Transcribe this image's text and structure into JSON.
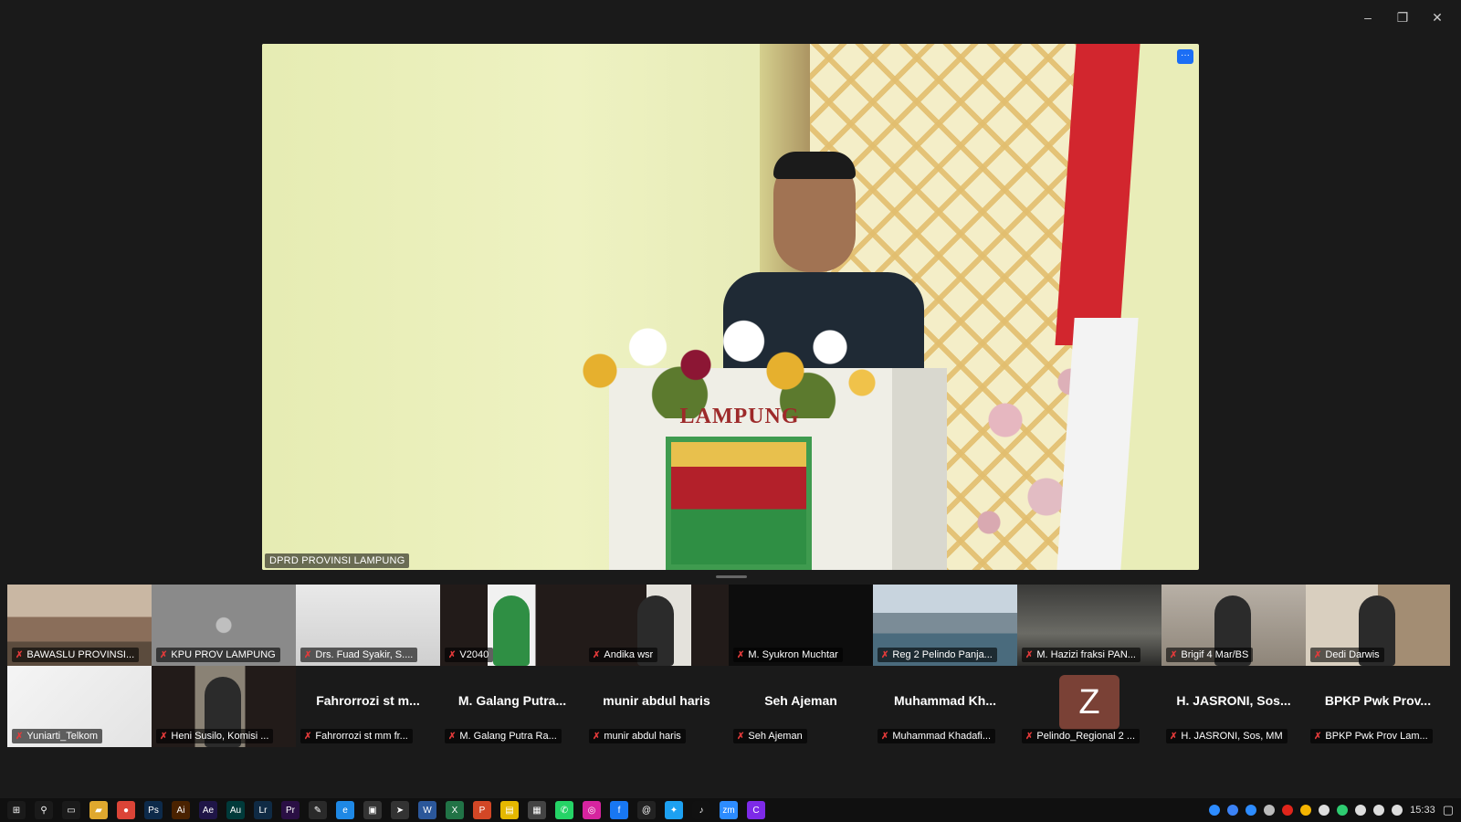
{
  "window": {
    "minimize": "–",
    "restore": "❐",
    "close": "✕"
  },
  "main_video": {
    "label": "DPRD PROVINSI LAMPUNG",
    "podium_text": "LAMPUNG",
    "more_button": "···"
  },
  "gallery": [
    {
      "name": "BAWASLU PROVINSI...",
      "center": "",
      "style": "photo-building",
      "avatar": ""
    },
    {
      "name": "KPU PROV LAMPUNG",
      "center": "",
      "style": "photo-gray",
      "avatar": ""
    },
    {
      "name": "Drs. Fuad Syakir, S....",
      "center": "",
      "style": "photo-light",
      "avatar": ""
    },
    {
      "name": "V2040",
      "center": "",
      "style": "photo-person-green",
      "avatar": ""
    },
    {
      "name": "Andika wsr",
      "center": "",
      "style": "photo-person-suit",
      "avatar": ""
    },
    {
      "name": "M. Syukron Muchtar",
      "center": "",
      "style": "photo-dark",
      "avatar": ""
    },
    {
      "name": "Reg 2 Pelindo Panja...",
      "center": "",
      "style": "photo-port",
      "avatar": ""
    },
    {
      "name": "M. Hazizi fraksi PAN...",
      "center": "",
      "style": "photo-room",
      "avatar": ""
    },
    {
      "name": "Brigif 4 Mar/BS",
      "center": "",
      "style": "photo-person-face",
      "avatar": ""
    },
    {
      "name": "Dedi Darwis",
      "center": "",
      "style": "photo-person-office",
      "avatar": ""
    },
    {
      "name": "Yuniarti_Telkom",
      "center": "",
      "style": "photo-telkom",
      "avatar": ""
    },
    {
      "name": "Heni Susilo, Komisi ...",
      "center": "",
      "style": "photo-person-dark",
      "avatar": ""
    },
    {
      "name": "Fahrorrozi st mm fr...",
      "center": "Fahrorrozi st m...",
      "style": "none",
      "avatar": ""
    },
    {
      "name": "M. Galang Putra Ra...",
      "center": "M. Galang Putra...",
      "style": "none",
      "avatar": ""
    },
    {
      "name": "munir abdul haris",
      "center": "munir abdul haris",
      "style": "none",
      "avatar": ""
    },
    {
      "name": "Seh Ajeman",
      "center": "Seh Ajeman",
      "style": "none",
      "avatar": ""
    },
    {
      "name": "Muhammad Khadafi...",
      "center": "Muhammad Kh...",
      "style": "none",
      "avatar": ""
    },
    {
      "name": "Pelindo_Regional 2 ...",
      "center": "",
      "style": "none",
      "avatar": "Z"
    },
    {
      "name": "H. JASRONI, Sos, MM",
      "center": "H. JASRONI, Sos...",
      "style": "none",
      "avatar": ""
    },
    {
      "name": "BPKP Pwk Prov Lam...",
      "center": "BPKP Pwk Prov...",
      "style": "none",
      "avatar": ""
    }
  ],
  "mic_muted_glyph": "✗",
  "taskbar": {
    "apps": [
      {
        "icon": "windows-icon",
        "glyph": "⊞",
        "color": "#1a1a1a"
      },
      {
        "icon": "search-icon",
        "glyph": "⚲",
        "color": "#1a1a1a"
      },
      {
        "icon": "task-view-icon",
        "glyph": "▭",
        "color": "#1a1a1a"
      },
      {
        "icon": "file-explorer-icon",
        "glyph": "▰",
        "color": "#e0a82e"
      },
      {
        "icon": "chrome-icon",
        "glyph": "●",
        "color": "#db4437"
      },
      {
        "icon": "photoshop-icon",
        "glyph": "Ps",
        "color": "#0d2a4a"
      },
      {
        "icon": "illustrator-icon",
        "glyph": "Ai",
        "color": "#4a2200"
      },
      {
        "icon": "aftereffects-icon",
        "glyph": "Ae",
        "color": "#1f1547"
      },
      {
        "icon": "audition-icon",
        "glyph": "Au",
        "color": "#003a3a"
      },
      {
        "icon": "lightroom-icon",
        "glyph": "Lr",
        "color": "#0f2a44"
      },
      {
        "icon": "premiere-icon",
        "glyph": "Pr",
        "color": "#2a0f44"
      },
      {
        "icon": "pen-tool-icon",
        "glyph": "✎",
        "color": "#2a2a2a"
      },
      {
        "icon": "edge-icon",
        "glyph": "e",
        "color": "#1e88e5"
      },
      {
        "icon": "app-box-icon",
        "glyph": "▣",
        "color": "#333"
      },
      {
        "icon": "arrow-app-icon",
        "glyph": "➤",
        "color": "#333"
      },
      {
        "icon": "word-icon",
        "glyph": "W",
        "color": "#2b579a"
      },
      {
        "icon": "excel-icon",
        "glyph": "X",
        "color": "#217346"
      },
      {
        "icon": "powerpoint-icon",
        "glyph": "P",
        "color": "#d24726"
      },
      {
        "icon": "sticky-notes-icon",
        "glyph": "▤",
        "color": "#e5b800"
      },
      {
        "icon": "calculator-icon",
        "glyph": "▦",
        "color": "#444"
      },
      {
        "icon": "whatsapp-icon",
        "glyph": "✆",
        "color": "#25d366"
      },
      {
        "icon": "instagram-icon",
        "glyph": "◎",
        "color": "#d6249f"
      },
      {
        "icon": "facebook-icon",
        "glyph": "f",
        "color": "#1877f2"
      },
      {
        "icon": "threads-icon",
        "glyph": "@",
        "color": "#222"
      },
      {
        "icon": "twitter-icon",
        "glyph": "✦",
        "color": "#1da1f2"
      },
      {
        "icon": "tiktok-icon",
        "glyph": "♪",
        "color": "#111"
      },
      {
        "icon": "zoom-icon",
        "glyph": "zm",
        "color": "#2d8cff"
      },
      {
        "icon": "canva-icon",
        "glyph": "C",
        "color": "#7d2ae8"
      }
    ],
    "tray": [
      {
        "icon": "tray-app-icon",
        "color": "#2d8cff"
      },
      {
        "icon": "tray-dropbox-icon",
        "color": "#3b82f6"
      },
      {
        "icon": "tray-zoom-icon",
        "color": "#2d8cff"
      },
      {
        "icon": "tray-cloud-icon",
        "color": "#bbbbbb"
      },
      {
        "icon": "tray-adobe-icon",
        "color": "#e1251b"
      },
      {
        "icon": "tray-chrome-icon",
        "color": "#f4b400"
      },
      {
        "icon": "tray-shield-icon",
        "color": "#dddddd"
      },
      {
        "icon": "tray-sync-icon",
        "color": "#2ecc71"
      },
      {
        "icon": "tray-security-icon",
        "color": "#dddddd"
      },
      {
        "icon": "network-icon",
        "color": "#dddddd"
      },
      {
        "icon": "volume-icon",
        "color": "#dddddd"
      }
    ],
    "clock": "15:33",
    "notifications_glyph": "▢"
  }
}
